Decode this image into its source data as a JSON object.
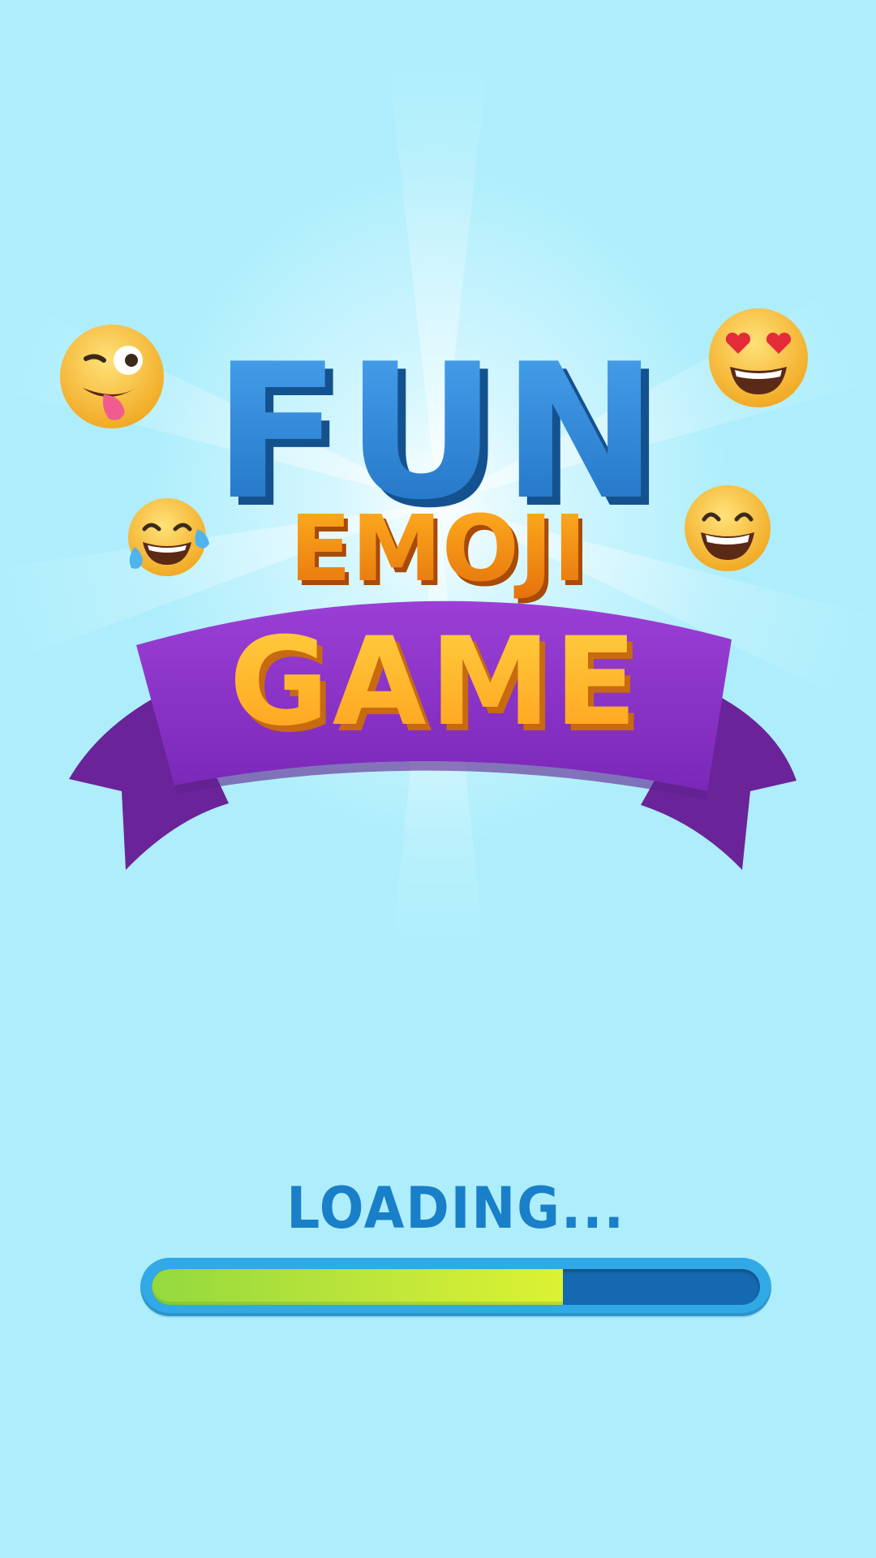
{
  "title": {
    "line1": "FUN",
    "line2": "EMOJI",
    "line3": "GAME"
  },
  "emojis": [
    {
      "name": "winking-tongue-emoji-icon"
    },
    {
      "name": "heart-eyes-emoji-icon"
    },
    {
      "name": "tears-of-joy-emoji-icon"
    },
    {
      "name": "grinning-smiling-eyes-emoji-icon"
    }
  ],
  "loading": {
    "label": "LOADING...",
    "progress": 0.676
  },
  "colors": {
    "background": "#aeeefc",
    "fun_blue": "#2f86d6",
    "emoji_orange": "#f08a12",
    "game_yellow": "#ffb320",
    "ribbon_purple": "#8a32c8",
    "loading_text": "#1a7fc9",
    "bar_track": "#1569b0",
    "bar_fill": "#c3e83a"
  }
}
